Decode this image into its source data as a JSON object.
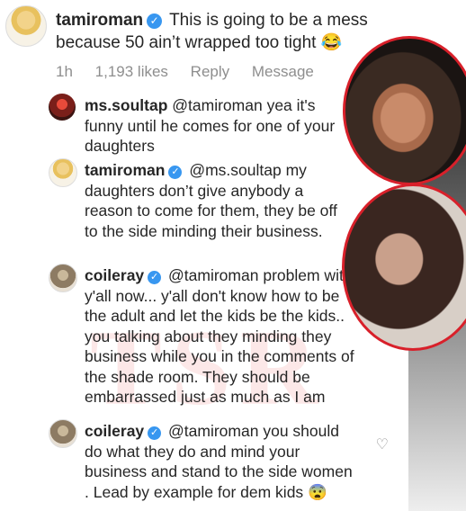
{
  "post": {
    "username": "tamiroman",
    "text": "This is going to be a mess because 50 ain’t wrapped too tight",
    "emoji": "😂",
    "meta": {
      "time": "1h",
      "likes": "1,193 likes",
      "reply": "Reply",
      "message": "Message"
    }
  },
  "comments": [
    {
      "username": "ms.soultap",
      "mention": "@tamiroman",
      "text": "yea it's funny until he comes for one of your daughters"
    },
    {
      "username": "tamiroman",
      "mention": "@ms.soultap",
      "text": "my daughters don’t give anybody a reason to come for them, they be off to the side minding their business."
    },
    {
      "username": "coileray",
      "mention": "@tamiroman",
      "text": "problem with y'all now... y'all don't know how to be the adult and let the kids be the kids.. you talking about they minding they business while you in the comments of the shade room. They should be embarrassed just as much as I am"
    },
    {
      "username": "coileray",
      "mention": "@tamiroman",
      "text": "you should do what they do and mind your business and stand to the side women . Lead by example for dem kids",
      "emoji": "😨"
    }
  ],
  "watermark": "TSR",
  "icons": {
    "verified": "verified-badge-icon",
    "heart": "heart-icon"
  },
  "colors": {
    "verified": "#3897f0",
    "meta": "#8e8e8e",
    "photo_border": "#d8202a"
  }
}
